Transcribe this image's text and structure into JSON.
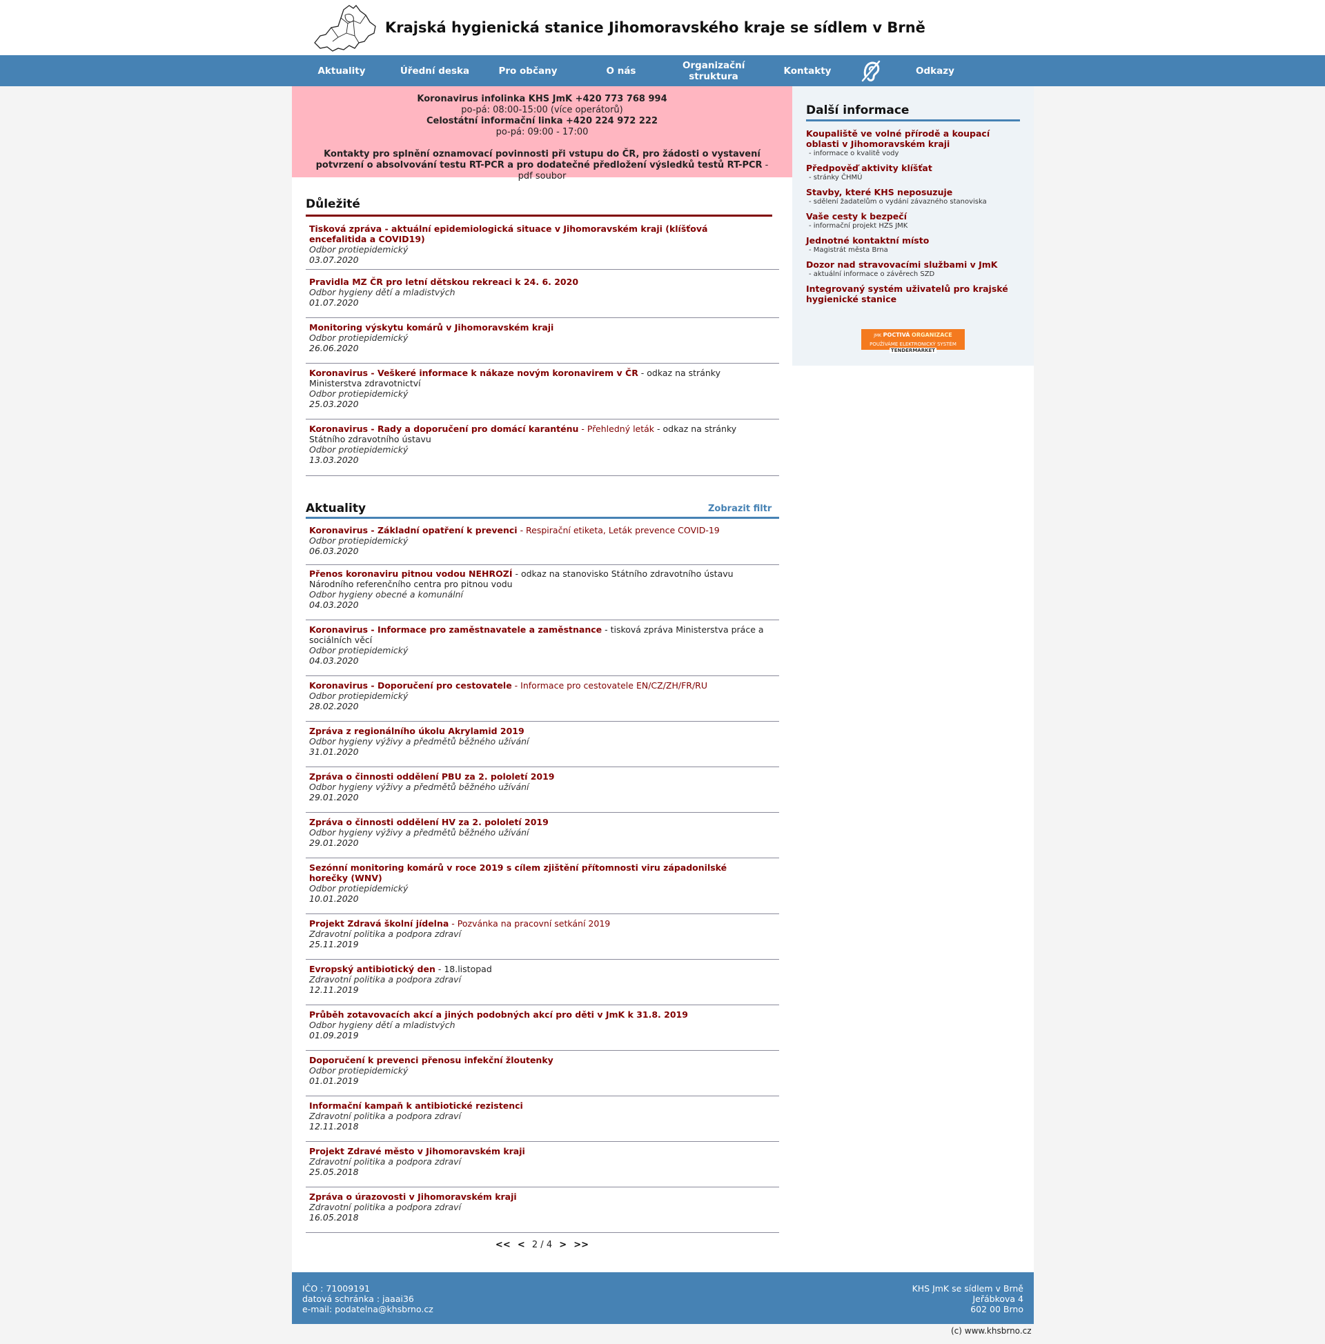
{
  "header": {
    "site_title": "Krajská hygienická stanice Jihomoravského kraje se sídlem v Brně"
  },
  "nav": {
    "items": [
      "Aktuality",
      "Úřední deska",
      "Pro občany",
      "O nás",
      "Organizační struktura",
      "Kontakty",
      "Odkazy"
    ]
  },
  "alert": {
    "line1": "Koronavirus infolinka KHS JmK +420 773 768 994",
    "line2": "po-pá: 08:00-15:00 (více operátorů)",
    "line3": "Celostátní informační linka +420 224 972 222",
    "line4": "po-pá: 09:00 - 17:00",
    "line5_bold": "Kontakty pro splnění oznamovací povinnosti při vstupu do ČR, pro žádosti o vystavení potvrzení o absolvování testu RT-PCR a pro dodatečné předložení výsledků testů RT-PCR",
    "line5_note": " - pdf soubor"
  },
  "important": {
    "title": "Důležité",
    "items": [
      {
        "title": "Tisková zpráva - aktuální epidemiologická situace v Jihomoravském kraji (klíšťová encefalitida a COVID19)",
        "extra": "",
        "note": "",
        "dept": "Odbor protiepidemický",
        "date": "03.07.2020"
      },
      {
        "title": "Pravidla MZ ČR pro letní dětskou rekreaci k 24. 6. 2020",
        "extra": "",
        "note": "",
        "dept": "Odbor hygieny dětí a mladistvých",
        "date": "01.07.2020"
      },
      {
        "title": "Monitoring výskytu komárů v Jihomoravském kraji",
        "extra": "",
        "note": "",
        "dept": "Odbor protiepidemický",
        "date": "26.06.2020"
      },
      {
        "title": "Koronavirus - Veškeré informace k nákaze novým koronavirem v ČR",
        "extra": "",
        "note": " - odkaz na stránky Ministerstva zdravotnictví",
        "dept": "Odbor protiepidemický",
        "date": "25.03.2020"
      },
      {
        "title": "Koronavirus - Rady a doporučení pro domácí karanténu",
        "extra": " - Přehledný leták",
        "note": " - odkaz na stránky Státního zdravotního ústavu",
        "dept": "Odbor protiepidemický",
        "date": "13.03.2020"
      }
    ]
  },
  "news": {
    "title": "Aktuality",
    "filter_link": "Zobrazit filtr",
    "items": [
      {
        "title": "Koronavirus - Základní opatření k prevenci",
        "extra": " - Respirační etiketa, Leták prevence COVID-19",
        "note": "",
        "dept": "Odbor protiepidemický",
        "date": "06.03.2020"
      },
      {
        "title": "Přenos koronaviru pitnou vodou NEHROZÍ",
        "extra": "",
        "note": " - odkaz na stanovisko Státního zdravotního ústavu Národního referenčního centra pro pitnou vodu",
        "dept": "Odbor hygieny obecné a komunální",
        "date": "04.03.2020"
      },
      {
        "title": "Koronavirus - Informace pro zaměstnavatele a zaměstnance",
        "extra": "",
        "note": " - tisková zpráva Ministerstva práce a sociálních věcí",
        "dept": "Odbor protiepidemický",
        "date": "04.03.2020"
      },
      {
        "title": "Koronavirus - Doporučení pro cestovatele",
        "extra": " - Informace pro cestovatele EN/CZ/ZH/FR/RU",
        "note": "",
        "dept": "Odbor protiepidemický",
        "date": "28.02.2020"
      },
      {
        "title": "Zpráva z regionálního úkolu Akrylamid 2019",
        "extra": "",
        "note": "",
        "dept": "Odbor hygieny výživy a předmětů běžného užívání",
        "date": "31.01.2020"
      },
      {
        "title": "Zpráva o činnosti oddělení PBU za 2. pololetí 2019",
        "extra": "",
        "note": "",
        "dept": "Odbor hygieny výživy a předmětů běžného užívání",
        "date": "29.01.2020"
      },
      {
        "title": "Zpráva o činnosti oddělení HV za 2. pololetí 2019",
        "extra": "",
        "note": "",
        "dept": "Odbor hygieny výživy a předmětů běžného užívání",
        "date": "29.01.2020"
      },
      {
        "title": "Sezónní monitoring komárů v roce 2019 s cílem zjištění přítomnosti viru západonilské horečky (WNV)",
        "extra": "",
        "note": "",
        "dept": "Odbor protiepidemický",
        "date": "10.01.2020"
      },
      {
        "title": "Projekt Zdravá školní jídelna",
        "extra": " - Pozvánka na pracovní setkání 2019",
        "note": "",
        "dept": "Zdravotní politika a podpora zdraví",
        "date": "25.11.2019"
      },
      {
        "title": "Evropský antibiotický den",
        "extra": "",
        "note": " - 18.listopad",
        "dept": "Zdravotní politika a podpora zdraví",
        "date": "12.11.2019"
      },
      {
        "title": "Průběh zotavovacích akcí a jiných podobných akcí pro děti v JmK k 31.8. 2019",
        "extra": "",
        "note": "",
        "dept": "Odbor hygieny dětí a mladistvých",
        "date": "01.09.2019"
      },
      {
        "title": "Doporučení k prevenci přenosu infekční žloutenky",
        "extra": "",
        "note": "",
        "dept": "Odbor protiepidemický",
        "date": "01.01.2019"
      },
      {
        "title": "Informační kampaň k antibiotické rezistenci",
        "extra": "",
        "note": "",
        "dept": "Zdravotní politika a podpora zdraví",
        "date": "12.11.2018"
      },
      {
        "title": "Projekt Zdravé město v Jihomoravském kraji",
        "extra": "",
        "note": "",
        "dept": "Zdravotní politika a podpora zdraví",
        "date": "25.05.2018"
      },
      {
        "title": "Zpráva o úrazovosti v Jihomoravském kraji",
        "extra": "",
        "note": "",
        "dept": "Zdravotní politika a podpora zdraví",
        "date": "16.05.2018"
      }
    ]
  },
  "pager": {
    "first": "<<",
    "prev": "<",
    "current": "2 / 4",
    "next": ">",
    "last": ">>"
  },
  "sidebar": {
    "title": "Další informace",
    "links": [
      {
        "title": "Koupaliště ve volné přírodě a koupací oblasti v Jihomoravském kraji",
        "sub": "- informace o kvalitě vody"
      },
      {
        "title": "Předpověď aktivity klíšťat",
        "sub": "- stránky ČHMÚ"
      },
      {
        "title": "Stavby, které KHS neposuzuje",
        "sub": "- sdělení žadatelům o vydání závazného stanoviska"
      },
      {
        "title": "Vaše cesty k bezpečí",
        "sub": "- informační projekt HZS JMK"
      },
      {
        "title": "Jednotné kontaktní místo",
        "sub": "- Magistrát města Brna"
      },
      {
        "title": "Dozor nad stravovacími službami v JmK",
        "sub": "- aktuální informace o závěrech SZD"
      },
      {
        "title": "Integrovaný systém uživatelů pro krajské hygienické stanice",
        "sub": ""
      }
    ],
    "badge": {
      "prefix": "JMK",
      "text1": "POCTIVÁ",
      "text2": "ORGANIZACE",
      "line2": "POUŽÍVÁME ELEKTRONICKÝ SYSTÉM",
      "brand": "TENDERMARKET"
    }
  },
  "footer": {
    "ico": "IČO : 71009191",
    "datovka": "datová schránka : jaaai36",
    "email": "e-mail: podatelna@khsbrno.cz",
    "org": "KHS JmK se sídlem v Brně",
    "street": "Jeřábkova 4",
    "city": "602 00 Brno",
    "copyright": "(c) www.khsbrno.cz"
  },
  "colors": {
    "nav": "#4682b4",
    "link": "#800000",
    "alert_bg": "#ffb6c1",
    "important_rule": "#800000",
    "news_rule": "#4682b4"
  }
}
